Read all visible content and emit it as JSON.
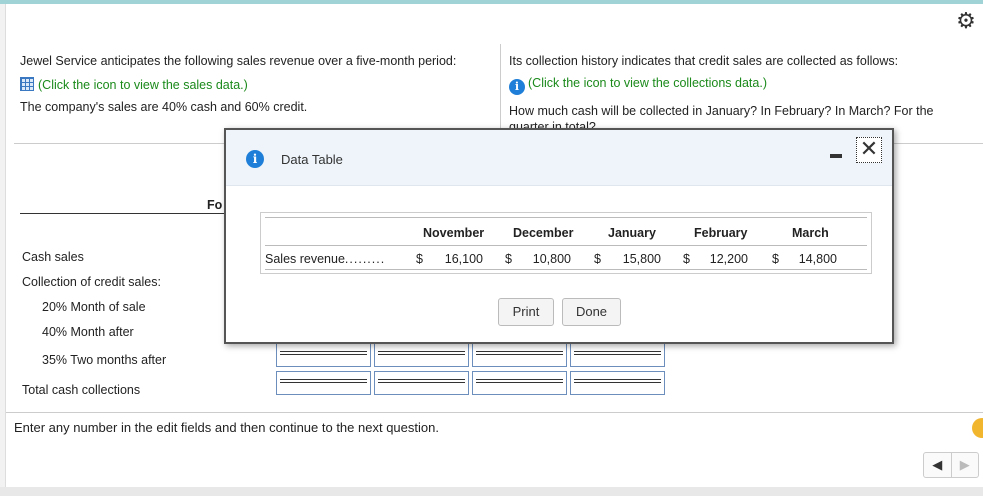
{
  "question": {
    "left_intro": "Jewel Service anticipates the following sales revenue over a five-month period:",
    "left_link": "(Click the icon to view the sales data.)",
    "left_note": "The company's sales are 40% cash and 60% credit.",
    "right_intro": "Its collection history indicates that credit sales are collected as follows:",
    "right_link": "(Click the icon to view the collections data.)",
    "right_question": "How much cash will be collected in January? In February? In March? For the quarter in total?"
  },
  "schedule": {
    "header_fragment": "Fo",
    "rows": [
      "Cash sales",
      "Collection of credit sales:",
      "20% Month of sale",
      "40% Month after",
      "35% Two months after",
      "Total cash collections"
    ]
  },
  "footer": {
    "instruction": "Enter any number in the edit fields and then continue to the next question."
  },
  "modal": {
    "title": "Data Table",
    "close_glyph": "✕",
    "columns": [
      "November",
      "December",
      "January",
      "February",
      "March"
    ],
    "row_label": "Sales revenue",
    "row_dots": ".........",
    "currency": "$",
    "values": [
      "16,100",
      "10,800",
      "15,800",
      "12,200",
      "14,800"
    ],
    "print_label": "Print",
    "done_label": "Done"
  },
  "nav": {
    "prev": "◀",
    "next": "▶"
  },
  "icons": {
    "gear": "gear-icon",
    "grid": "grid-table-icon",
    "info": "info-icon"
  }
}
